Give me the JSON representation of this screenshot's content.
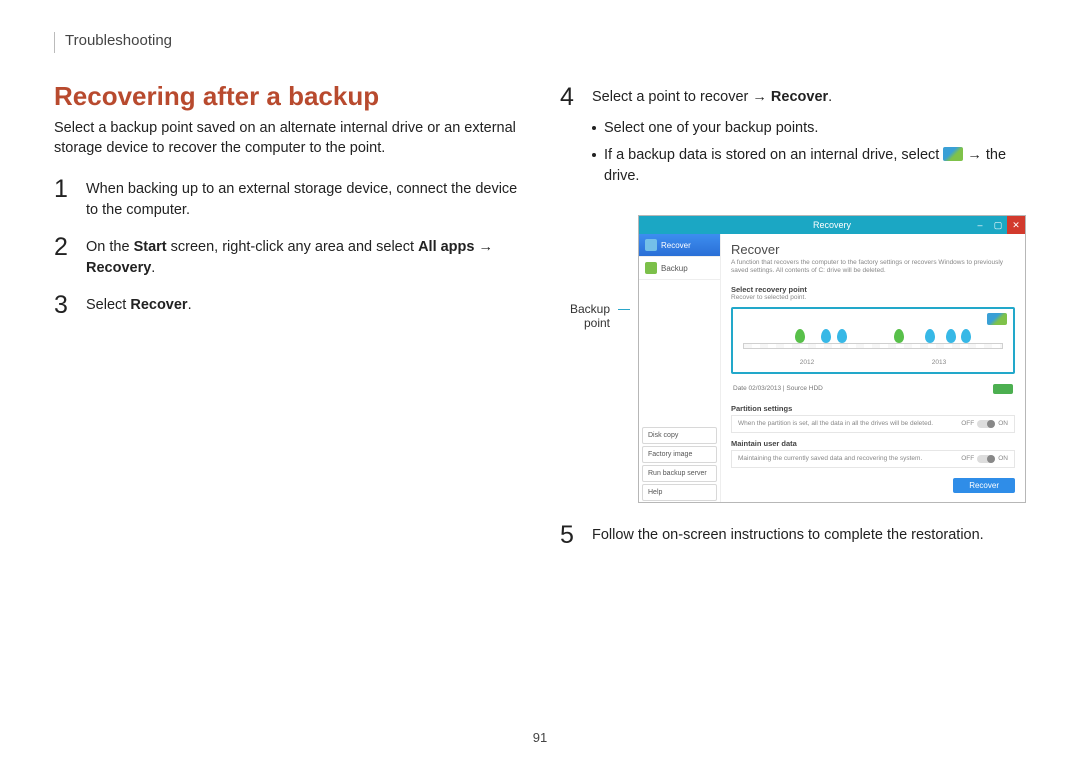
{
  "breadcrumb": "Troubleshooting",
  "heading": "Recovering after a backup",
  "intro": "Select a backup point saved on an alternate internal drive or an external storage device to recover the computer to the point.",
  "steps": {
    "1": {
      "num": "1",
      "text": "When backing up to an external storage device, connect the device to the computer."
    },
    "2": {
      "num": "2",
      "pre": "On the ",
      "b1": "Start",
      "mid": " screen, right-click any area and select ",
      "b2": "All apps",
      "arrow": " → ",
      "b3": "Recovery",
      "post": "."
    },
    "3": {
      "num": "3",
      "pre": "Select ",
      "b1": "Recover",
      "post": "."
    },
    "4": {
      "num": "4",
      "pre": "Select a point to recover → ",
      "b1": "Recover",
      "post": ".",
      "bullet_a": "Select one of your backup points.",
      "bullet_b_pre": "If a backup data is stored on an internal drive, select ",
      "bullet_b_post": " → the drive."
    },
    "5": {
      "num": "5",
      "text": "Follow the on-screen instructions to complete the restoration."
    }
  },
  "callout": {
    "line1": "Backup",
    "line2": "point"
  },
  "screenshot": {
    "title": "Recovery",
    "side_recover": "Recover",
    "side_backup": "Backup",
    "bot_diskcopy": "Disk copy",
    "bot_factory": "Factory image",
    "bot_runserver": "Run backup server",
    "bot_help": "Help",
    "main_title": "Recover",
    "main_desc": "A function that recovers the computer to the factory settings or recovers Windows to previously saved settings. All contents of C: drive will be deleted.",
    "sec1_title": "Select recovery point",
    "sec1_desc": "Recover to selected point.",
    "year_a": "2012",
    "year_b": "2013",
    "meta": "Date   02/03/2013   |   Source   HDD",
    "sec2_title": "Partition settings",
    "sec2_desc": "When the partition is set, all the data in all the drives will be deleted.",
    "sec3_title": "Maintain user data",
    "sec3_desc": "Maintaining the currently saved data and recovering the system.",
    "off": "OFF",
    "on": "ON",
    "recover_btn": "Recover"
  },
  "page_number": "91"
}
